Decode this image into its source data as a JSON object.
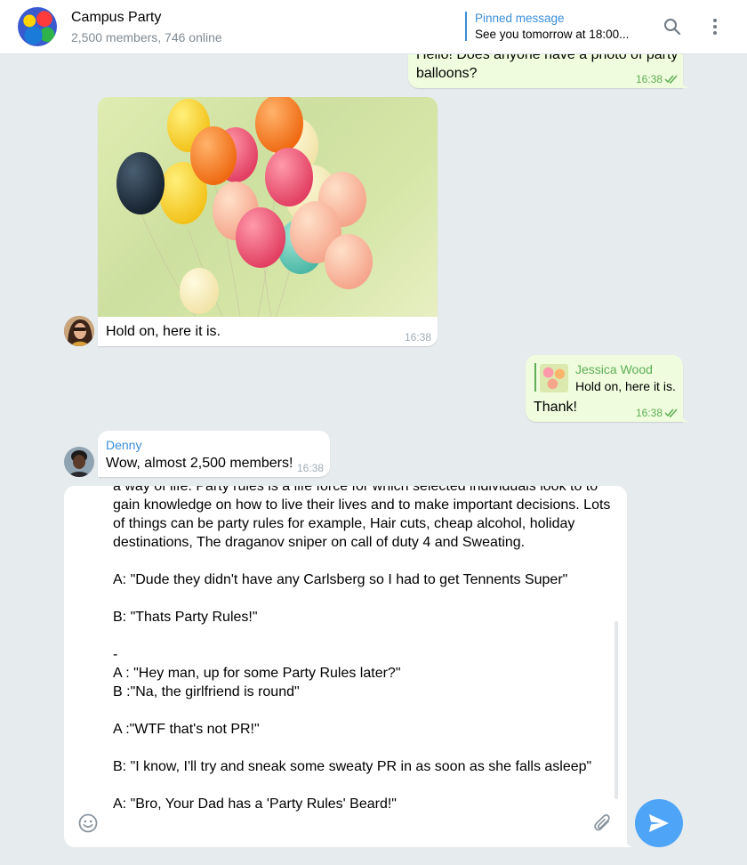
{
  "header": {
    "title": "Campus Party",
    "subtitle": "2,500 members, 746 online",
    "pinned_title": "Pinned message",
    "pinned_text": "See you tomorrow at 18:00..."
  },
  "messages": {
    "m1": {
      "text": "Hello! Does anyone have a photo of party balloons?",
      "time": "16:38"
    },
    "m2": {
      "text": "Hold on, here it is.",
      "time": "16:38"
    },
    "m3": {
      "reply_author": "Jessica Wood",
      "reply_text": "Hold on, here it is.",
      "text": "Thank!",
      "time": "16:38"
    },
    "m4": {
      "author": "Denny",
      "text": "Wow, almost 2,500 members!",
      "time": "16:38"
    }
  },
  "composer": {
    "text": "a way of life. Party rules is a life force for which selected individuals look to to gain knowledge on how to live their lives and to make important decisions. Lots of things can be party rules for example, Hair cuts, cheap alcohol, holiday destinations, The draganov sniper on call of duty 4 and Sweating.\n\nA: \"Dude they didn't have any Carlsberg so I had to get Tennents Super\"\n\nB: \"Thats Party Rules!\"\n\n-\nA : \"Hey man, up for some Party Rules later?\"\nB :\"Na, the girlfriend is round\"\n\nA :\"WTF that's not PR!\"\n\nB: \"I know, I'll try and sneak some sweaty PR in as soon as she falls asleep\"\n\nA: \"Bro, Your Dad has a 'Party Rules' Beard!\""
  },
  "colors": {
    "accent": "#3a8fd9",
    "outgoing_bubble": "#effdde",
    "send_button": "#4ea4f6",
    "time_out": "#5fad56"
  }
}
